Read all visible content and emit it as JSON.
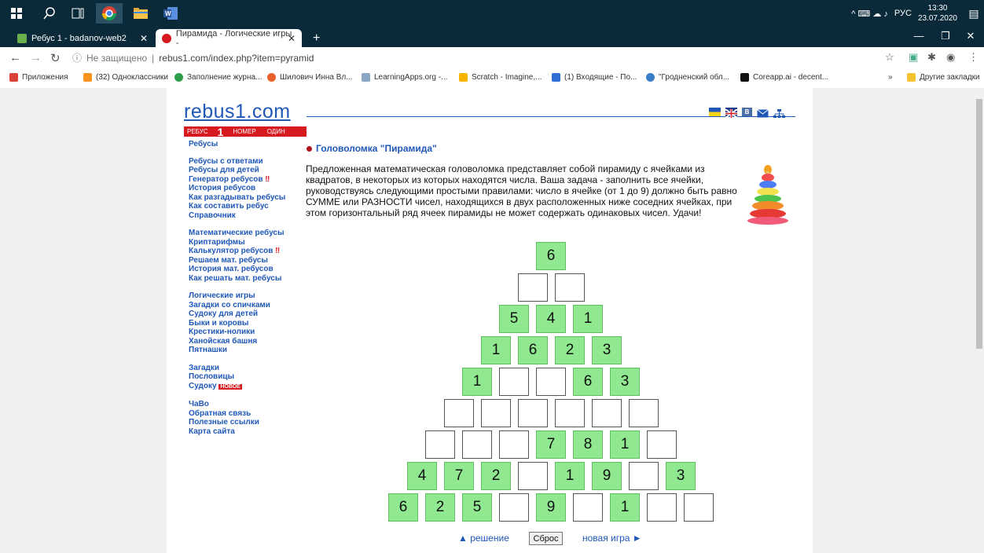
{
  "taskbar": {
    "lang": "РУС",
    "time": "13:30",
    "date": "23.07.2020",
    "sys_icons": "^ ⌨ ☁ ♪"
  },
  "tabs": [
    {
      "label": "Ребус 1 - badanov-web2",
      "close": "✕"
    },
    {
      "label": "Пирамида - Логические игры -",
      "close": "✕"
    }
  ],
  "new_tab": "+",
  "window_controls": [
    "—",
    "❐",
    "✕"
  ],
  "address": {
    "security": "Не защищено",
    "url": "rebus1.com/index.php?item=pyramid"
  },
  "bookmarks": [
    {
      "label": "Приложения",
      "color": "#d9413a"
    },
    {
      "label": "(32) Одноклассники",
      "color": "#f7931e"
    },
    {
      "label": "Заполнение журна...",
      "color": "#2e9e4c"
    },
    {
      "label": "Шилович Инна Вл...",
      "color": "#e8612c"
    },
    {
      "label": "LearningApps.org -...",
      "color": "#8aa6c2"
    },
    {
      "label": "Scratch - Imagine,...",
      "color": "#f7b500"
    },
    {
      "label": "(1) Входящие - По...",
      "color": "#2f6fd3"
    },
    {
      "label": "\"Гродненский обл...",
      "color": "#3a7fc6"
    },
    {
      "label": "Coreapp.ai - decent...",
      "color": "#111111"
    }
  ],
  "bookmarks_more": "»",
  "bookmarks_other": "Другие закладки",
  "site": {
    "logo": "rebus1.com",
    "strip": [
      "РЕБУС",
      "1",
      "НОМЕР",
      "ОДИН"
    ],
    "menu": [
      [
        "Ребусы"
      ],
      [
        "Ребусы с ответами",
        "Ребусы для детей",
        "Генератор ребусов",
        "История ребусов",
        "Как разгадывать ребусы",
        "Как составить ребус",
        "Справочник"
      ],
      [
        "Математические ребусы",
        "Криптарифмы",
        "Калькулятор ребусов",
        "Решаем мат. ребусы",
        "История мат. ребусов",
        "Как решать мат. ребусы"
      ],
      [
        "Логические игры",
        "Загадки со спичками",
        "Судоку для детей",
        "Быки и коровы",
        "Крестики-нолики",
        "Ханойская башня",
        "Пятнашки"
      ],
      [
        "Загадки",
        "Пословицы",
        "Судоку"
      ],
      [
        "ЧаВо",
        "Обратная связь",
        "Полезные ссылки",
        "Карта сайта"
      ]
    ],
    "warn_mark": "‼",
    "new_badge": "НОВОЕ",
    "title": "Головоломка \"Пирамида\"",
    "description": "Предложенная математическая головоломка представляет собой пирамиду с ячейками из квадратов, в некоторых из которых находятся числа. Ваша задача - заполнить все ячейки, руководствуясь следующими простыми правилами: число в ячейке (от 1 до 9) должно быть равно СУММЕ или РАЗНОСТИ чисел, находящихся в двух расположенных ниже соседних ячейках, при этом горизонтальный ряд ячеек пирамиды не может содержать одинаковых чисел. Удачи!",
    "pyramid": [
      [
        "6"
      ],
      [
        "",
        ""
      ],
      [
        "5",
        "4",
        "1"
      ],
      [
        "1",
        "6",
        "2",
        "3"
      ],
      [
        "1",
        "",
        "",
        "6",
        "3"
      ],
      [
        "",
        "",
        "",
        "",
        "",
        ""
      ],
      [
        "",
        "",
        "",
        "7",
        "8",
        "1",
        ""
      ],
      [
        "4",
        "7",
        "2",
        "",
        "1",
        "9",
        "",
        "3"
      ],
      [
        "6",
        "2",
        "5",
        "",
        "9",
        "",
        "1",
        "",
        ""
      ]
    ],
    "solution_link": "▲ решение",
    "reset_button": "Сброс",
    "new_game_link": "новая игра ►"
  },
  "colors": {
    "accent": "#1f58b8",
    "cell_filled": "#90e890",
    "logo_red": "#d71920"
  }
}
